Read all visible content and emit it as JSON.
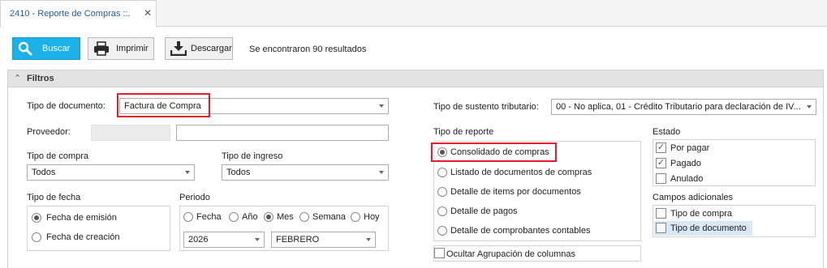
{
  "tab": {
    "title": "2410 - Reporte de Compras ::.",
    "close": "✕"
  },
  "toolbar": {
    "buscar": "Buscar",
    "imprimir": "Imprimir",
    "descargar": "Descargar",
    "results": "Se encontraron 90 resultados",
    "accent_color": "#1ab0e8"
  },
  "filtros": {
    "title": "Filtros",
    "tipo_documento": {
      "label": "Tipo de documento:",
      "value": "Factura de Compra"
    },
    "proveedor": {
      "label": "Proveedor:",
      "code": "",
      "name": ""
    },
    "tipo_compra": {
      "label": "Tipo de compra",
      "value": "Todos"
    },
    "tipo_ingreso": {
      "label": "Tipo de ingreso",
      "value": "Todos"
    },
    "tipo_fecha": {
      "label": "Tipo de fecha",
      "options": [
        "Fecha de emisión",
        "Fecha de creación"
      ],
      "selected": "Fecha de emisión"
    },
    "periodo": {
      "label": "Periodo",
      "options": [
        "Fecha",
        "Año",
        "Mes",
        "Semana",
        "Hoy"
      ],
      "selected": "Mes",
      "year": "2026",
      "month": "FEBRERO"
    },
    "sustento": {
      "label": "Tipo de sustento tributario:",
      "value": "00 - No aplica, 01 - Crédito Tributario para declaración de IV..."
    },
    "tipo_reporte": {
      "label": "Tipo de reporte",
      "options": [
        "Consolidado de compras",
        "Listado de documentos de compras",
        "Detalle de items por documentos",
        "Detalle de pagos",
        "Detalle de comprobantes contables"
      ],
      "selected": "Consolidado de compras"
    },
    "ocultar": {
      "label": "Ocultar Agrupación de columnas",
      "checked": false
    },
    "estado": {
      "label": "Estado",
      "items": [
        {
          "label": "Por pagar",
          "checked": true
        },
        {
          "label": "Pagado",
          "checked": true
        },
        {
          "label": "Anulado",
          "checked": false
        }
      ]
    },
    "campos": {
      "label": "Campos adicionales",
      "items": [
        {
          "label": "Tipo de compra",
          "checked": false
        },
        {
          "label": "Tipo de documento",
          "checked": false
        }
      ]
    },
    "highlight_color": "#e31d2b"
  }
}
